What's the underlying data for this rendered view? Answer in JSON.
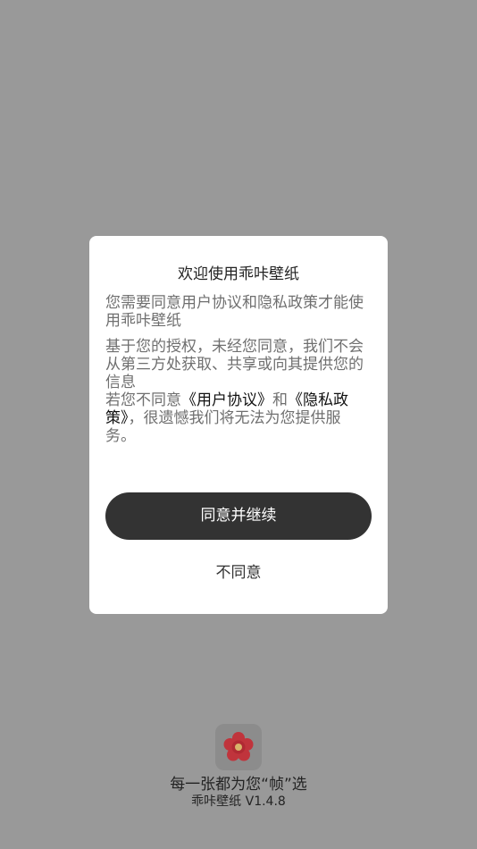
{
  "dialog": {
    "title": "欢迎使用乖咔壁纸",
    "paragraph1": "您需要同意用户协议和隐私政策才能使用乖咔壁纸",
    "paragraph2": "基于您的授权，未经您同意，我们不会从第三方处获取、共享或向其提供您的信息",
    "p3_prefix": " 若您不同意",
    "user_agreement_link": "《用户协议》",
    "and_word": "和",
    "privacy_policy_link": "《隐私政策》",
    "p3_suffix": "，很遗憾我们将无法为您提供服务。",
    "agree_label": "同意并继续",
    "disagree_label": "不同意"
  },
  "footer": {
    "app_icon": "flower-icon",
    "slogan": "每一张都为您“帧”选",
    "version": "乖咔壁纸 V1.4.8"
  },
  "colors": {
    "overlay": "#999999",
    "dialog_background": "#ffffff",
    "agree_button": "#333333",
    "icon_flower": "#c0343c",
    "icon_center": "#d8b36a"
  }
}
